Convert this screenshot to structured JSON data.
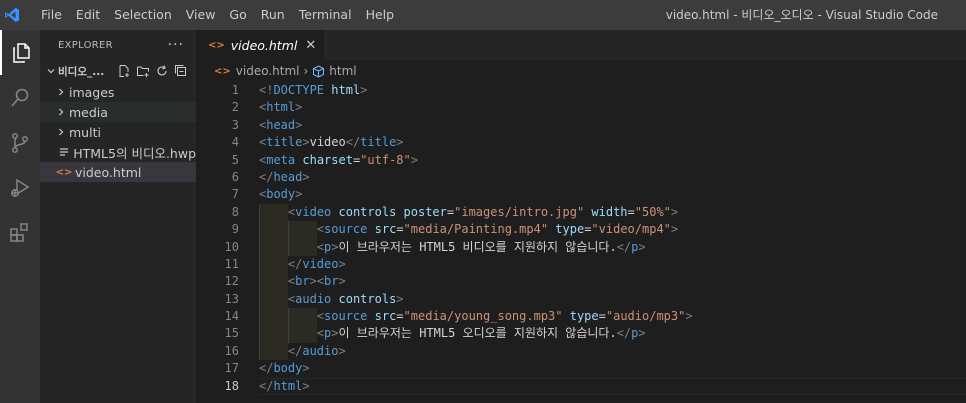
{
  "titlebar": {
    "menus": [
      "File",
      "Edit",
      "Selection",
      "View",
      "Go",
      "Run",
      "Terminal",
      "Help"
    ],
    "window_title": "video.html - 비디오_오디오 - Visual Studio Code"
  },
  "colors": {
    "titlebar_bg": "#3c3c3c",
    "activitybar_bg": "#333333",
    "sidebar_bg": "#252526",
    "editor_bg": "#1e1e1e",
    "vscode_blue": "#3794ff",
    "html_icon": "#e37933"
  },
  "activitybar": {
    "icons": [
      "explorer-icon",
      "search-icon",
      "source-control-icon",
      "run-debug-icon",
      "extensions-icon"
    ]
  },
  "sidebar": {
    "title": "EXPLORER",
    "more": "···",
    "folder": "비디오_...",
    "items": [
      {
        "label": "images",
        "type": "folder"
      },
      {
        "label": "media",
        "type": "folder"
      },
      {
        "label": "multi",
        "type": "folder"
      },
      {
        "label": "HTML5의 비디오.hwp",
        "type": "file"
      },
      {
        "label": "video.html",
        "type": "html"
      }
    ]
  },
  "editor": {
    "tab_label": "video.html",
    "tab_icon": "<>",
    "tab_close": "✕",
    "breadcrumb": {
      "file": "video.html",
      "separator": "›",
      "symbol": "html"
    },
    "current_line": 18,
    "lines": [
      {
        "n": "1",
        "tokens": [
          [
            "tag",
            "<!"
          ],
          [
            "tn",
            "DOCTYPE"
          ],
          [
            "tx",
            " "
          ],
          [
            "an",
            "html"
          ],
          [
            "tag",
            ">"
          ]
        ]
      },
      {
        "n": "2",
        "tokens": [
          [
            "tag",
            "<"
          ],
          [
            "tn",
            "html"
          ],
          [
            "tag",
            ">"
          ]
        ]
      },
      {
        "n": "3",
        "tokens": [
          [
            "tag",
            "<"
          ],
          [
            "tn",
            "head"
          ],
          [
            "tag",
            ">"
          ]
        ]
      },
      {
        "n": "4",
        "tokens": [
          [
            "tag",
            "<"
          ],
          [
            "tn",
            "title"
          ],
          [
            "tag",
            ">"
          ],
          [
            "tx",
            "video"
          ],
          [
            "tag",
            "</"
          ],
          [
            "tn",
            "title"
          ],
          [
            "tag",
            ">"
          ]
        ]
      },
      {
        "n": "5",
        "tokens": [
          [
            "tag",
            "<"
          ],
          [
            "tn",
            "meta"
          ],
          [
            "tx",
            " "
          ],
          [
            "an",
            "charset"
          ],
          [
            "eq",
            "="
          ],
          [
            "av",
            "\"utf-8\""
          ],
          [
            "tag",
            ">"
          ]
        ]
      },
      {
        "n": "6",
        "tokens": [
          [
            "tag",
            "</"
          ],
          [
            "tn",
            "head"
          ],
          [
            "tag",
            ">"
          ]
        ]
      },
      {
        "n": "7",
        "tokens": [
          [
            "tag",
            "<"
          ],
          [
            "tn",
            "body"
          ],
          [
            "tag",
            ">"
          ]
        ]
      },
      {
        "n": "8",
        "tokens": [
          [
            "tx",
            "    "
          ],
          [
            "tag",
            "<"
          ],
          [
            "tn",
            "video"
          ],
          [
            "tx",
            " "
          ],
          [
            "an",
            "controls"
          ],
          [
            "tx",
            " "
          ],
          [
            "an",
            "poster"
          ],
          [
            "eq",
            "="
          ],
          [
            "av",
            "\"images/intro.jpg\""
          ],
          [
            "tx",
            " "
          ],
          [
            "an",
            "width"
          ],
          [
            "eq",
            "="
          ],
          [
            "av",
            "\"50%\""
          ],
          [
            "tag",
            ">"
          ]
        ]
      },
      {
        "n": "9",
        "tokens": [
          [
            "tx",
            "        "
          ],
          [
            "tag",
            "<"
          ],
          [
            "tn",
            "source"
          ],
          [
            "tx",
            " "
          ],
          [
            "an",
            "src"
          ],
          [
            "eq",
            "="
          ],
          [
            "av",
            "\"media/Painting.mp4\""
          ],
          [
            "tx",
            " "
          ],
          [
            "an",
            "type"
          ],
          [
            "eq",
            "="
          ],
          [
            "av",
            "\"video/mp4\""
          ],
          [
            "tag",
            ">"
          ]
        ]
      },
      {
        "n": "10",
        "tokens": [
          [
            "tx",
            "        "
          ],
          [
            "tag",
            "<"
          ],
          [
            "tn",
            "p"
          ],
          [
            "tag",
            ">"
          ],
          [
            "tx",
            "이 브라우저는 HTML5 비디오를 지원하지 않습니다."
          ],
          [
            "tag",
            "</"
          ],
          [
            "tn",
            "p"
          ],
          [
            "tag",
            ">"
          ]
        ]
      },
      {
        "n": "11",
        "tokens": [
          [
            "tx",
            "    "
          ],
          [
            "tag",
            "</"
          ],
          [
            "tn",
            "video"
          ],
          [
            "tag",
            ">"
          ]
        ]
      },
      {
        "n": "12",
        "tokens": [
          [
            "tx",
            "    "
          ],
          [
            "tag",
            "<"
          ],
          [
            "tn",
            "br"
          ],
          [
            "tag",
            "><"
          ],
          [
            "tn",
            "br"
          ],
          [
            "tag",
            ">"
          ]
        ]
      },
      {
        "n": "13",
        "tokens": [
          [
            "tx",
            "    "
          ],
          [
            "tag",
            "<"
          ],
          [
            "tn",
            "audio"
          ],
          [
            "tx",
            " "
          ],
          [
            "an",
            "controls"
          ],
          [
            "tag",
            ">"
          ]
        ]
      },
      {
        "n": "14",
        "tokens": [
          [
            "tx",
            "        "
          ],
          [
            "tag",
            "<"
          ],
          [
            "tn",
            "source"
          ],
          [
            "tx",
            " "
          ],
          [
            "an",
            "src"
          ],
          [
            "eq",
            "="
          ],
          [
            "av",
            "\"media/young_song.mp3\""
          ],
          [
            "tx",
            " "
          ],
          [
            "an",
            "type"
          ],
          [
            "eq",
            "="
          ],
          [
            "av",
            "\"audio/mp3\""
          ],
          [
            "tag",
            ">"
          ]
        ]
      },
      {
        "n": "15",
        "tokens": [
          [
            "tx",
            "        "
          ],
          [
            "tag",
            "<"
          ],
          [
            "tn",
            "p"
          ],
          [
            "tag",
            ">"
          ],
          [
            "tx",
            "이 브라우저는 HTML5 오디오를 지원하지 않습니다."
          ],
          [
            "tag",
            "</"
          ],
          [
            "tn",
            "p"
          ],
          [
            "tag",
            ">"
          ]
        ]
      },
      {
        "n": "16",
        "tokens": [
          [
            "tx",
            "    "
          ],
          [
            "tag",
            "</"
          ],
          [
            "tn",
            "audio"
          ],
          [
            "tag",
            ">"
          ]
        ]
      },
      {
        "n": "17",
        "tokens": [
          [
            "tag",
            "</"
          ],
          [
            "tn",
            "body"
          ],
          [
            "tag",
            ">"
          ]
        ]
      },
      {
        "n": "18",
        "tokens": [
          [
            "tag",
            "</"
          ],
          [
            "tn",
            "html"
          ],
          [
            "tag",
            ">"
          ]
        ]
      }
    ]
  }
}
